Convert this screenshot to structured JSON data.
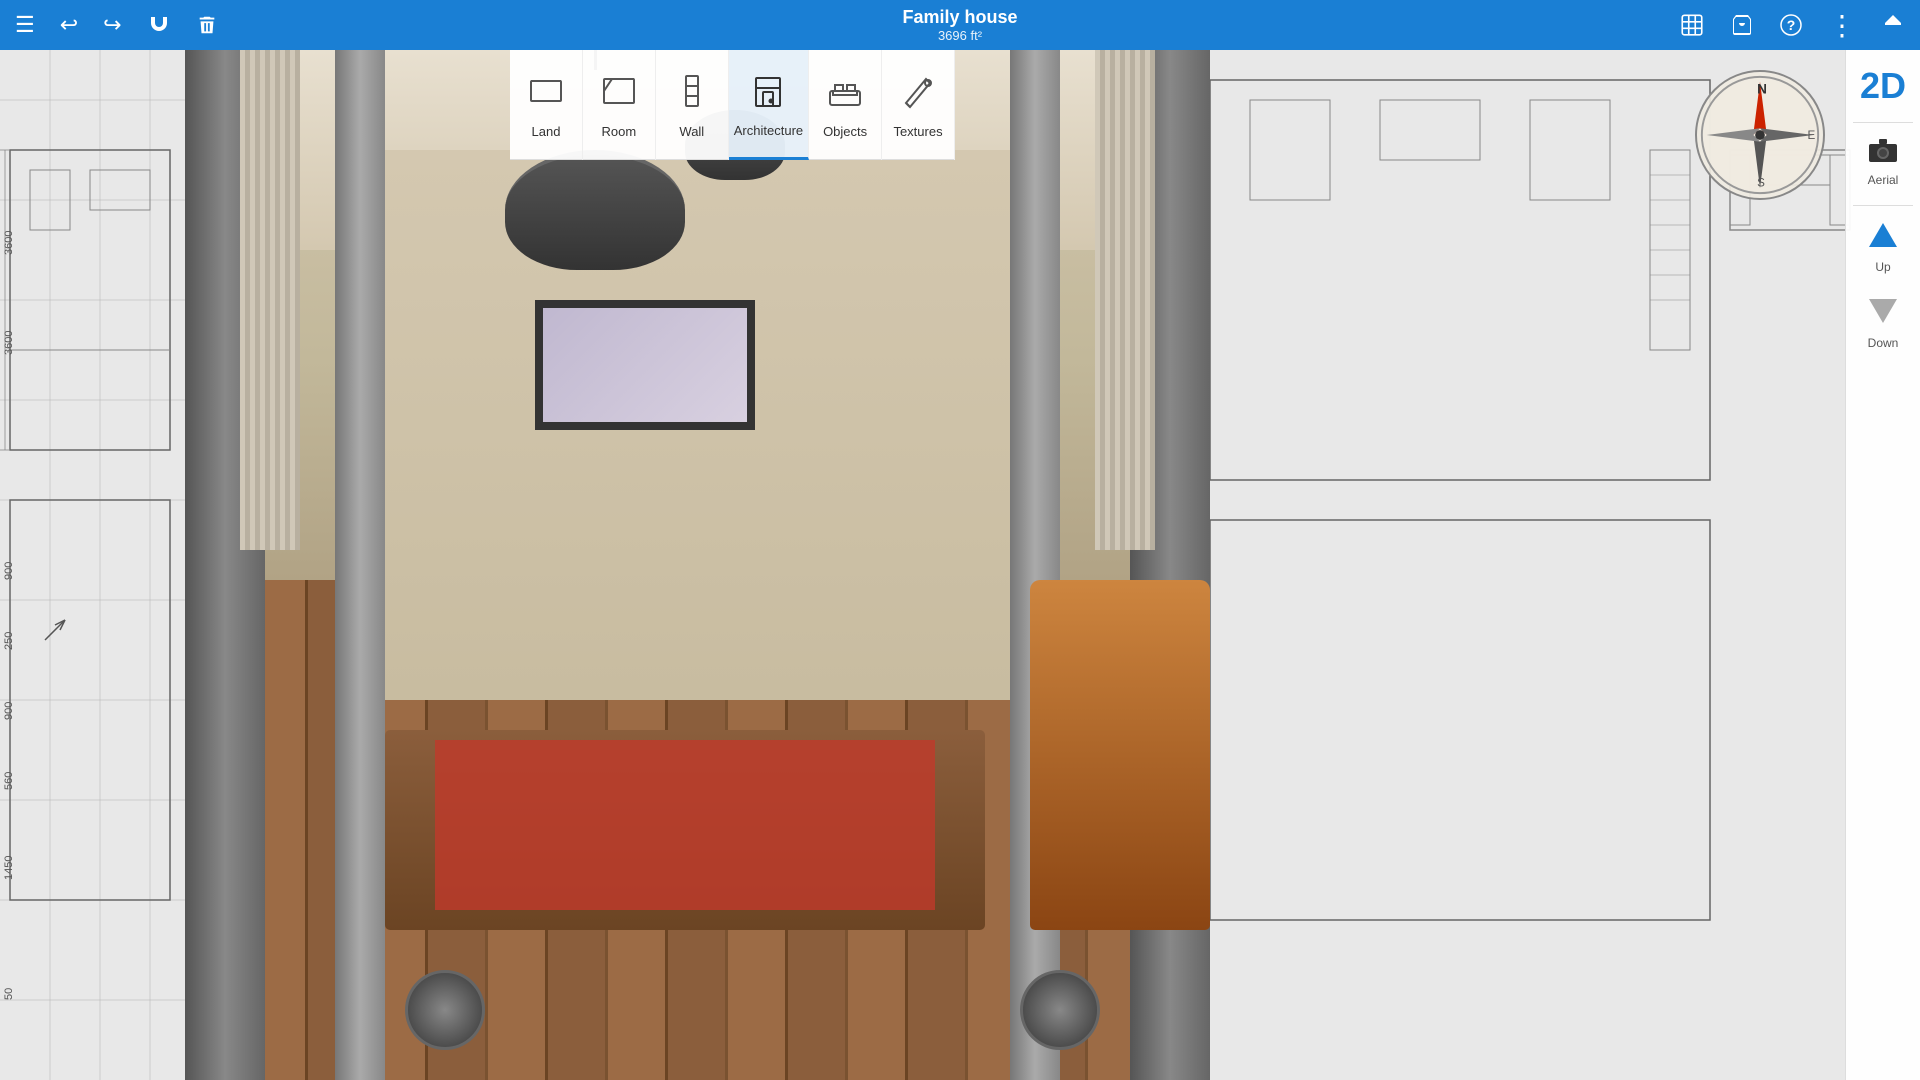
{
  "app": {
    "title": "Family house",
    "subtitle": "3696 ft²"
  },
  "toolbar": {
    "icons": {
      "menu": "☰",
      "undo": "↩",
      "redo": "↪",
      "magnet": "🔗",
      "trash": "🗑",
      "settings_3d": "⚙",
      "cart": "🛒",
      "help": "?",
      "more": "⋮",
      "share": "▲"
    }
  },
  "tools": [
    {
      "id": "land",
      "label": "Land",
      "icon": "◱",
      "active": false
    },
    {
      "id": "room",
      "label": "Room",
      "icon": "⬜",
      "active": false
    },
    {
      "id": "wall",
      "label": "Wall",
      "icon": "▯",
      "active": false
    },
    {
      "id": "architecture",
      "label": "Architecture",
      "icon": "🚪",
      "active": true
    },
    {
      "id": "objects",
      "label": "Objects",
      "icon": "🛋",
      "active": false
    },
    {
      "id": "textures",
      "label": "Textures",
      "icon": "✏",
      "active": false
    }
  ],
  "sidebar": {
    "view_2d_label": "2D",
    "aerial_label": "Aerial",
    "up_label": "Up",
    "down_label": "Down"
  },
  "compass": {
    "n": "N",
    "s": "S",
    "e": "E"
  }
}
